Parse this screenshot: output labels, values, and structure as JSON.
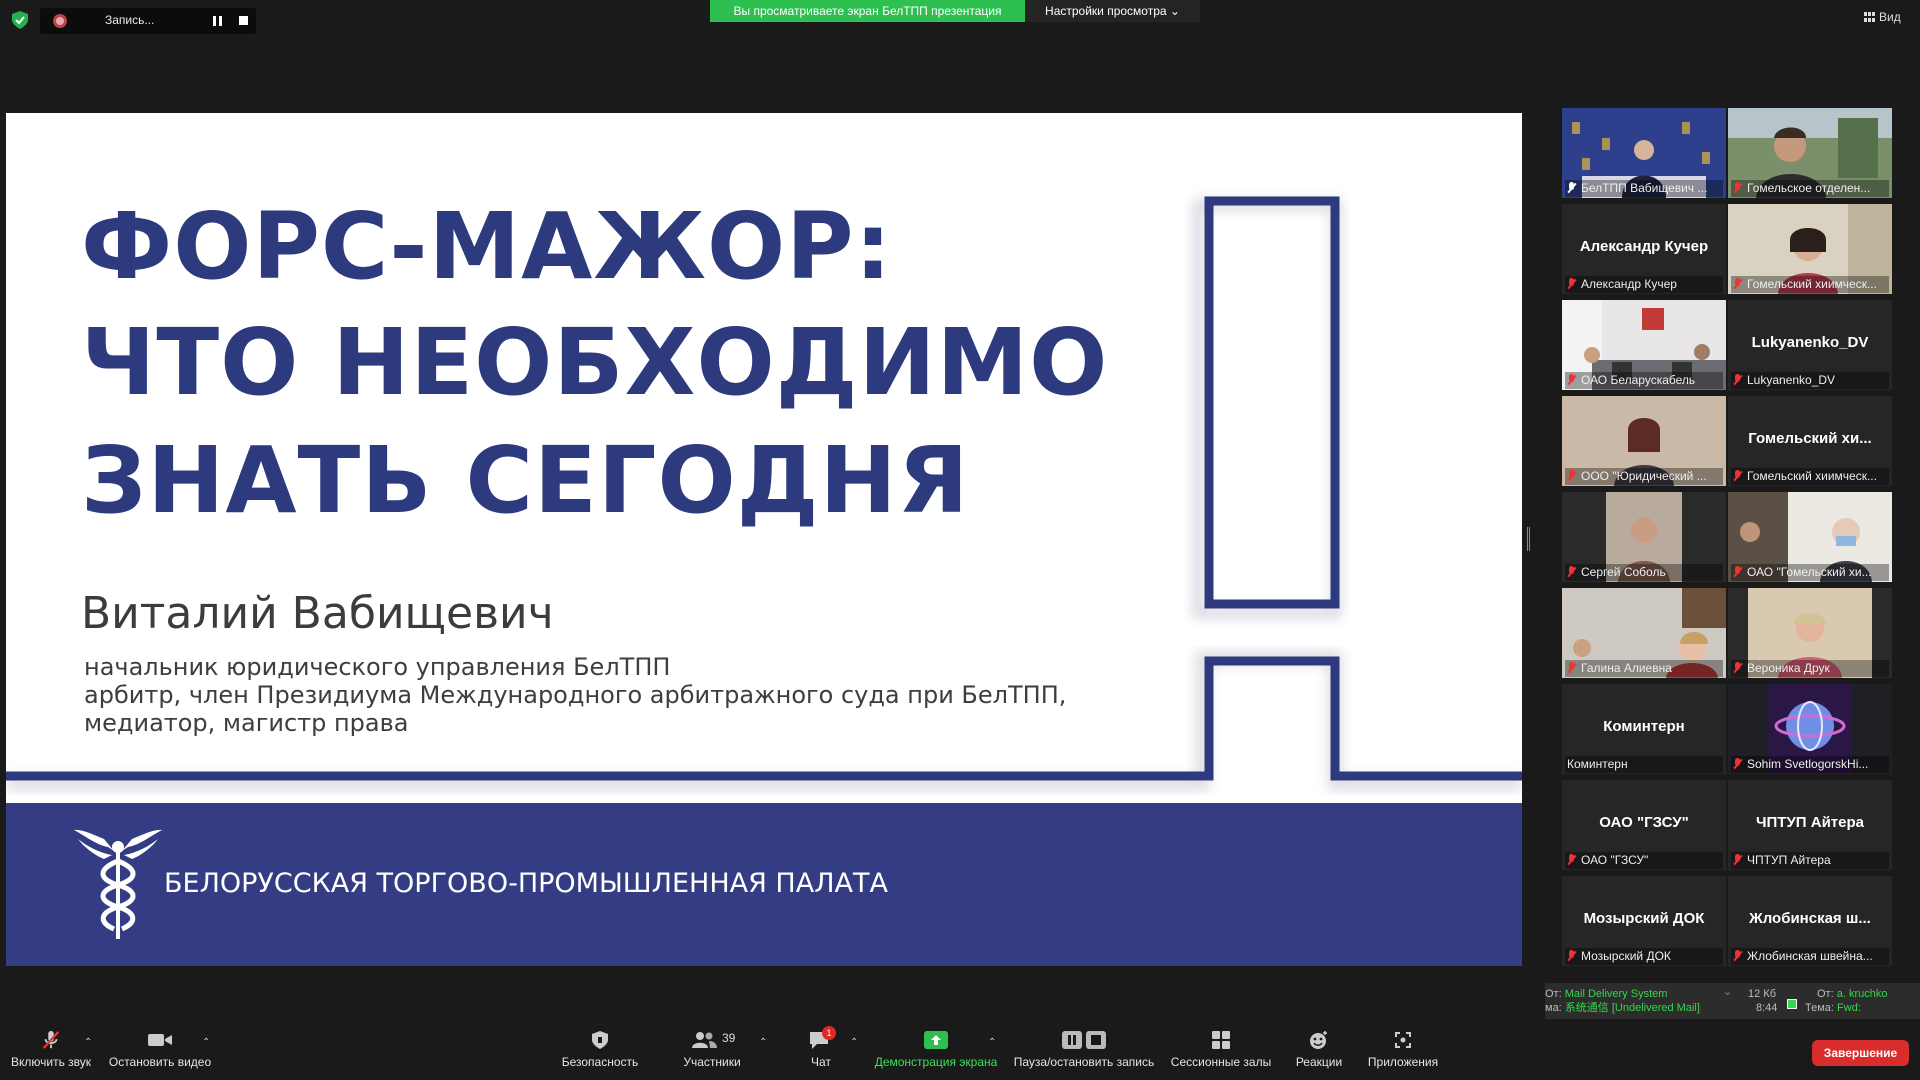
{
  "top": {
    "recording_label": "Запись...",
    "share_banner": "Вы просматриваете экран БелТПП презентация",
    "view_options": "Настройки просмотра ⌄",
    "view_button": "Вид"
  },
  "slide": {
    "title_lines": [
      "ФОРС-МАЖОР:",
      "ЧТО НЕОБХОДИМО",
      "ЗНАТЬ СЕГОДНЯ"
    ],
    "speaker": "Виталий Вабищевич",
    "description": [
      "начальник юридического управления БелТПП",
      "арбитр, член Президиума Международного арбитражного суда при БелТПП,",
      "медиатор, магистр права"
    ],
    "organization": "БЕЛОРУССКАЯ ТОРГОВО-ПРОМЫШЛЕННАЯ ПАЛАТА",
    "colors": {
      "primary": "#2d3a7e",
      "band": "#343d84"
    }
  },
  "participants": [
    {
      "name": "БелТПП Вабищевич ...",
      "big": "",
      "muted": false,
      "video": "blue-stage",
      "active": true
    },
    {
      "name": "Гомельское отделен...",
      "big": "",
      "muted": true,
      "video": "outdoor-man"
    },
    {
      "name": "Александр Кучер",
      "big": "Александр Кучер",
      "muted": true,
      "video": ""
    },
    {
      "name": "Гомельский хиимческ...",
      "big": "",
      "muted": true,
      "video": "woman-office"
    },
    {
      "name": "ОАО Беларускабель",
      "big": "",
      "muted": true,
      "video": "meeting-room"
    },
    {
      "name": "Lukyanenko_DV",
      "big": "Lukyanenko_DV",
      "muted": true,
      "video": ""
    },
    {
      "name": "ООО \"Юридический ...",
      "big": "",
      "muted": true,
      "video": "woman-wall"
    },
    {
      "name": "Гомельский хиимческ...",
      "big": "Гомельский хи...",
      "muted": true,
      "video": ""
    },
    {
      "name": "Сергей Соболь",
      "big": "",
      "muted": true,
      "video": "man-dark"
    },
    {
      "name": "ОАО \"Гомельский хи...",
      "big": "",
      "muted": true,
      "video": "office-mask"
    },
    {
      "name": "Галина Алиевна",
      "big": "",
      "muted": true,
      "video": "office-group"
    },
    {
      "name": "Вероника Друк",
      "big": "",
      "muted": true,
      "video": "woman-light"
    },
    {
      "name": "Коминтерн",
      "big": "Коминтерн",
      "muted": false,
      "video": ""
    },
    {
      "name": "Sohim SvetlogorskHi...",
      "big": "",
      "muted": true,
      "video": "globe"
    },
    {
      "name": "ОАО \"ГЗСУ\"",
      "big": "ОАО \"ГЗСУ\"",
      "muted": true,
      "video": ""
    },
    {
      "name": "ЧПТУП Айтера",
      "big": "ЧПТУП Айтера",
      "muted": true,
      "video": ""
    },
    {
      "name": "Мозырский ДОК",
      "big": "Мозырский ДОК",
      "muted": true,
      "video": ""
    },
    {
      "name": "Жлобинская швейна...",
      "big": "Жлобинская ш...",
      "muted": true,
      "video": ""
    }
  ],
  "notification": {
    "from_label": "От:",
    "from_value": "Mail Delivery System",
    "subject_label": "ма:",
    "subject_value": "系统通信 [Undelivered Mail]",
    "size": "12 Кб",
    "time": "8:44",
    "from2_label": "От:",
    "from2_value": "a. kruchko",
    "subject2_label": "Тема:",
    "subject2_value": "Fwd:"
  },
  "toolbar": {
    "unmute": "Включить звук",
    "stop_video": "Остановить видео",
    "security": "Безопасность",
    "participants": "Участники",
    "participants_count": "39",
    "chat": "Чат",
    "chat_badge": "1",
    "share_screen": "Демонстрация экрана",
    "pause_recording": "Пауза/остановить запись",
    "breakout_rooms": "Сессионные залы",
    "reactions": "Реакции",
    "apps": "Приложения",
    "end": "Завершение"
  }
}
